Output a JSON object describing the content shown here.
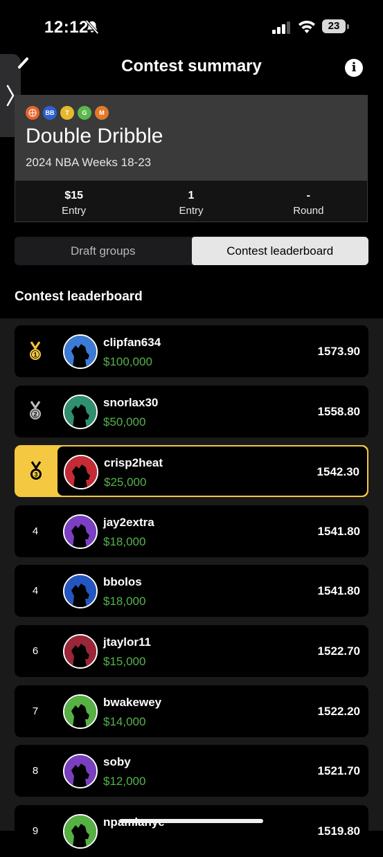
{
  "status_bar": {
    "time": "12:12",
    "battery": "23"
  },
  "header": {
    "title": "Contest summary",
    "info_label": "i"
  },
  "contest": {
    "chips": [
      {
        "label": "",
        "color": "#e8632b",
        "icon": "basketball-icon"
      },
      {
        "label": "BB",
        "color": "#2f5fd1"
      },
      {
        "label": "T",
        "color": "#e6b92d"
      },
      {
        "label": "G",
        "color": "#5bb84c"
      },
      {
        "label": "M",
        "color": "#e07a2b"
      }
    ],
    "name": "Double Dribble",
    "subtitle": "2024 NBA Weeks 18-23",
    "stats": [
      {
        "value": "$15",
        "label": "Entry"
      },
      {
        "value": "1",
        "label": "Entry"
      },
      {
        "value": "-",
        "label": "Round"
      }
    ]
  },
  "tabs": [
    {
      "label": "Draft groups",
      "active": false
    },
    {
      "label": "Contest leaderboard",
      "active": true
    }
  ],
  "section_title": "Contest leaderboard",
  "leaderboard": [
    {
      "rank": "1",
      "medal": "gold",
      "username": "clipfan634",
      "prize": "$100,000",
      "score": "1573.90",
      "avatar_color": "#3b7bd6"
    },
    {
      "rank": "2",
      "medal": "silver",
      "username": "snorlax30",
      "prize": "$50,000",
      "score": "1558.80",
      "avatar_color": "#2f8f6e"
    },
    {
      "rank": "3",
      "medal": "bronze",
      "username": "crisp2heat",
      "prize": "$25,000",
      "score": "1542.30",
      "avatar_color": "#c62b35",
      "highlighted": true
    },
    {
      "rank": "4",
      "username": "jay2extra",
      "prize": "$18,000",
      "score": "1541.80",
      "avatar_color": "#7b3fc4"
    },
    {
      "rank": "4",
      "username": "bbolos",
      "prize": "$18,000",
      "score": "1541.80",
      "avatar_color": "#2456c2"
    },
    {
      "rank": "6",
      "username": "jtaylor11",
      "prize": "$15,000",
      "score": "1522.70",
      "avatar_color": "#9a2638"
    },
    {
      "rank": "7",
      "username": "bwakewey",
      "prize": "$14,000",
      "score": "1522.20",
      "avatar_color": "#57b043"
    },
    {
      "rank": "8",
      "username": "soby",
      "prize": "$12,000",
      "score": "1521.70",
      "avatar_color": "#7a3fc0"
    },
    {
      "rank": "9",
      "username": "npamlanye",
      "prize": "",
      "score": "1519.80",
      "avatar_color": "#57b043"
    }
  ],
  "colors": {
    "accent_highlight": "#f5c842",
    "prize_green": "#55b34b",
    "gold": "#f5c842",
    "silver": "#bdbdbd"
  }
}
